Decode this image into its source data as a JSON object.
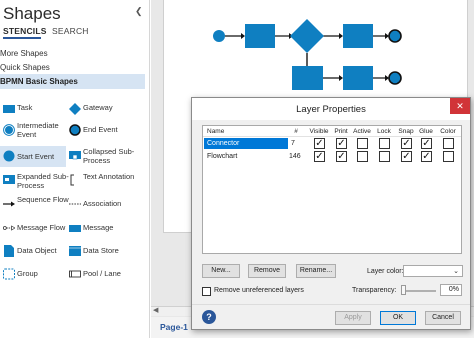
{
  "shapes_pane": {
    "title": "Shapes",
    "collapse_icon": "chevron-left-icon",
    "tabs": [
      "STENCILS",
      "SEARCH"
    ],
    "menu": [
      "More Shapes",
      "Quick Shapes"
    ],
    "active_stencil": "BPMN Basic Shapes",
    "shapes": [
      {
        "label": "Task",
        "icon": "task-rect-icon"
      },
      {
        "label": "Gateway",
        "icon": "gateway-diamond-icon"
      },
      {
        "label": "Intermediate Event",
        "icon": "intermediate-event-icon"
      },
      {
        "label": "End Event",
        "icon": "end-event-icon"
      },
      {
        "label": "Start Event",
        "icon": "start-event-icon"
      },
      {
        "label": "Collapsed Sub-Process",
        "icon": "collapsed-subprocess-icon"
      },
      {
        "label": "Expanded Sub-Process",
        "icon": "expanded-subprocess-icon"
      },
      {
        "label": "Text Annotation",
        "icon": "text-annotation-icon"
      },
      {
        "label": "Sequence Flow",
        "icon": "sequence-flow-icon"
      },
      {
        "label": "Association",
        "icon": "association-icon"
      },
      {
        "label": "Message Flow",
        "icon": "message-flow-icon"
      },
      {
        "label": "Message",
        "icon": "message-icon"
      },
      {
        "label": "Data Object",
        "icon": "data-object-icon"
      },
      {
        "label": "Data Store",
        "icon": "data-store-icon"
      },
      {
        "label": "Group",
        "icon": "group-icon"
      },
      {
        "label": "Pool / Lane",
        "icon": "pool-lane-icon"
      }
    ]
  },
  "page_tab": "Page-1",
  "dialog": {
    "title": "Layer Properties",
    "close_icon": "close-icon",
    "columns": [
      "Name",
      "#",
      "Visible",
      "Print",
      "Active",
      "Lock",
      "Snap",
      "Glue",
      "Color"
    ],
    "layers": [
      {
        "name": "Connector",
        "count": "7",
        "visible": true,
        "print": true,
        "active": false,
        "lock": false,
        "snap": true,
        "glue": true,
        "color": false
      },
      {
        "name": "Flowchart",
        "count": "146",
        "visible": true,
        "print": true,
        "active": false,
        "lock": false,
        "snap": true,
        "glue": true,
        "color": false
      }
    ],
    "buttons": {
      "new": "New...",
      "remove": "Remove",
      "rename": "Rename...",
      "apply": "Apply",
      "ok": "OK",
      "cancel": "Cancel"
    },
    "layer_color_label": "Layer color:",
    "remove_unreferenced_label": "Remove unreferenced layers",
    "transparency_label": "Transparency:",
    "transparency_value": "0%",
    "help_icon": "help-icon"
  },
  "colors": {
    "accent": "#2b579a",
    "shape_fill": "#0f7fc1",
    "selection": "#0078d7",
    "close": "#d13438"
  }
}
